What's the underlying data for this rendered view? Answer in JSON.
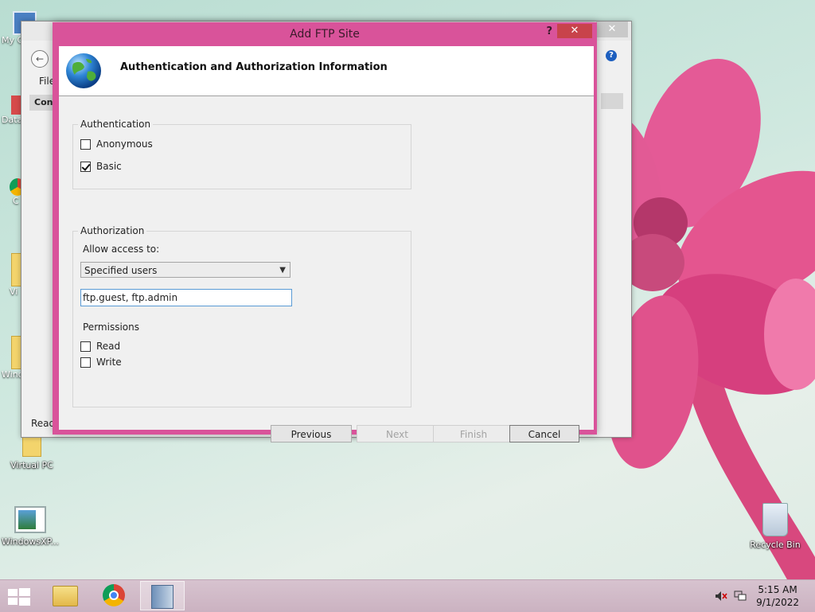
{
  "desktop": {
    "icons": [
      {
        "label": "My C",
        "icon": "computer-icon"
      },
      {
        "label": "Data",
        "icon": "shortcut-icon"
      },
      {
        "label": "C",
        "icon": "chrome-icon"
      },
      {
        "label": "Vi",
        "icon": "folder-icon"
      },
      {
        "label": "Wind",
        "icon": "folder-icon"
      },
      {
        "label": "Virtual PC",
        "icon": "virtual-pc-icon"
      },
      {
        "label": "WindowsXP...",
        "icon": "windows-xp-icon"
      },
      {
        "label": "Recycle Bin",
        "icon": "recycle-bin-icon"
      }
    ]
  },
  "background_window": {
    "menu_file": "File",
    "connections": "Conn",
    "status": "Ready",
    "close_glyph": "✕",
    "help_glyph": "?"
  },
  "dialog": {
    "title": "Add FTP Site",
    "help_glyph": "?",
    "close_glyph": "✕",
    "heading": "Authentication and Authorization Information",
    "authentication": {
      "group_label": "Authentication",
      "anonymous_label": "Anonymous",
      "anonymous_checked": false,
      "basic_label": "Basic",
      "basic_checked": true
    },
    "authorization": {
      "group_label": "Authorization",
      "allow_access_label": "Allow access to:",
      "allow_access_value": "Specified users",
      "users_value": "ftp.guest, ftp.admin",
      "permissions_label": "Permissions",
      "read_label": "Read",
      "read_checked": false,
      "write_label": "Write",
      "write_checked": false
    },
    "buttons": {
      "previous": "Previous",
      "next": "Next",
      "finish": "Finish",
      "cancel": "Cancel"
    }
  },
  "taskbar": {
    "time": "5:15 AM",
    "date": "9/1/2022",
    "pinned": [
      "file-explorer-icon",
      "chrome-icon",
      "iis-manager-icon"
    ]
  },
  "colors": {
    "dialog_frame": "#d9539a",
    "close_button": "#c8434b",
    "taskbar": "#d0b8c6"
  }
}
